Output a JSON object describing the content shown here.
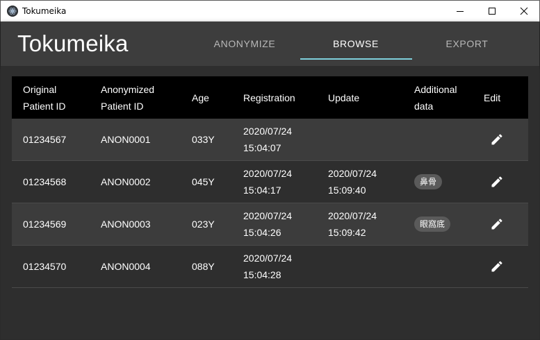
{
  "window": {
    "title": "Tokumeika",
    "icon": "app-icon",
    "controls": [
      "minimize-icon",
      "maximize-icon",
      "close-icon"
    ]
  },
  "header": {
    "brand": "Tokumeika",
    "tabs": [
      {
        "label": "ANONYMIZE",
        "active": false
      },
      {
        "label": "BROWSE",
        "active": true
      },
      {
        "label": "EXPORT",
        "active": false
      }
    ],
    "accent": "#7fd0dc"
  },
  "table": {
    "columns": [
      {
        "line1": "Original",
        "line2": "Patient ID"
      },
      {
        "line1": "Anonymized",
        "line2": "Patient ID"
      },
      {
        "line1": "Age",
        "line2": ""
      },
      {
        "line1": "Registration",
        "line2": ""
      },
      {
        "line1": "Update",
        "line2": ""
      },
      {
        "line1": "Additional",
        "line2": "data"
      },
      {
        "line1": "Edit",
        "line2": ""
      }
    ],
    "rows": [
      {
        "original_id": "01234567",
        "anon_id": "ANON0001",
        "age": "033Y",
        "reg_date": "2020/07/24",
        "reg_time": "15:04:07",
        "upd_date": "",
        "upd_time": "",
        "additional": ""
      },
      {
        "original_id": "01234568",
        "anon_id": "ANON0002",
        "age": "045Y",
        "reg_date": "2020/07/24",
        "reg_time": "15:04:17",
        "upd_date": "2020/07/24",
        "upd_time": "15:09:40",
        "additional": "鼻骨"
      },
      {
        "original_id": "01234569",
        "anon_id": "ANON0003",
        "age": "023Y",
        "reg_date": "2020/07/24",
        "reg_time": "15:04:26",
        "upd_date": "2020/07/24",
        "upd_time": "15:09:42",
        "additional": "眼窩底"
      },
      {
        "original_id": "01234570",
        "anon_id": "ANON0004",
        "age": "088Y",
        "reg_date": "2020/07/24",
        "reg_time": "15:04:28",
        "upd_date": "",
        "upd_time": "",
        "additional": ""
      }
    ],
    "edit_icon": "pencil-icon"
  }
}
